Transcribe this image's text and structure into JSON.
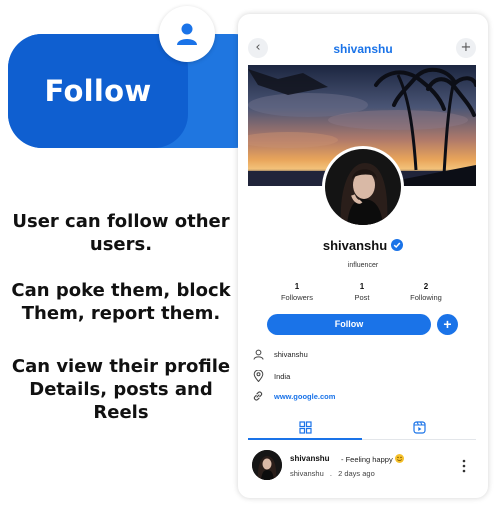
{
  "promo": {
    "title": "Follow",
    "lines_1": [
      "User can follow other",
      "users."
    ],
    "lines_2": [
      "Can poke them, block",
      "Them, report them."
    ],
    "lines_3": [
      "Can view their profile",
      "Details, posts and",
      "Reels"
    ]
  },
  "icons": {
    "promo": "user-icon",
    "back": "chevron-left-icon",
    "add": "plus-icon",
    "verified": "verified-badge-icon",
    "username": "user-outline-icon",
    "location": "location-pin-icon",
    "website": "link-icon",
    "grid_tab": "grid-icon",
    "reels_tab": "reels-icon",
    "post_menu": "more-vertical-icon"
  },
  "colors": {
    "accent": "#1a73e8",
    "promo_banner": "#1f76e0",
    "promo_banner_dark": "#0f5fd0"
  },
  "header": {
    "title": "shivanshu",
    "back_label": "‹",
    "add_label": "+"
  },
  "profile": {
    "name": "shivanshu",
    "bio": "influencer",
    "stats": [
      {
        "value": "1",
        "label": "Followers"
      },
      {
        "value": "1",
        "label": "Post"
      },
      {
        "value": "2",
        "label": "Following"
      }
    ],
    "follow_label": "Follow",
    "plus_label": "+",
    "details": {
      "username": "shivanshu",
      "location": "India",
      "website": "www.google.com"
    }
  },
  "post": {
    "author": "shivanshu",
    "feeling": "- Feeling happy",
    "sub_author": "shivanshu",
    "separator": ".",
    "time": "2 days ago"
  }
}
